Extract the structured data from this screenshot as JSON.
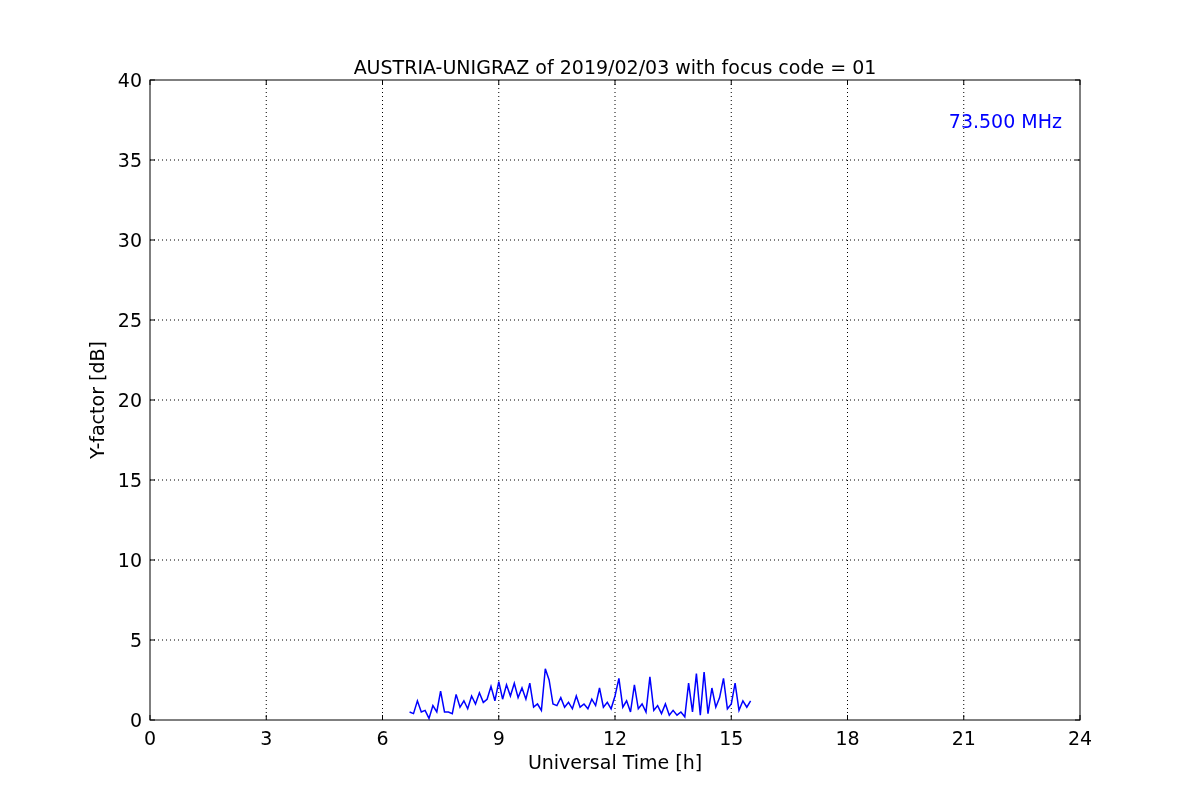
{
  "chart_data": {
    "type": "line",
    "title": "AUSTRIA-UNIGRAZ of 2019/02/03 with focus code = 01",
    "xlabel": "Universal Time [h]",
    "ylabel": "Y-factor [dB]",
    "xlim": [
      0,
      24
    ],
    "ylim": [
      0,
      40
    ],
    "xticks": [
      0,
      3,
      6,
      9,
      12,
      15,
      18,
      21,
      24
    ],
    "yticks": [
      0,
      5,
      10,
      15,
      20,
      25,
      30,
      35,
      40
    ],
    "x": [
      6.7,
      6.8,
      6.9,
      7.0,
      7.1,
      7.2,
      7.3,
      7.4,
      7.5,
      7.6,
      7.7,
      7.8,
      7.9,
      8.0,
      8.1,
      8.2,
      8.3,
      8.4,
      8.5,
      8.6,
      8.7,
      8.8,
      8.9,
      9.0,
      9.1,
      9.2,
      9.3,
      9.4,
      9.5,
      9.6,
      9.7,
      9.8,
      9.9,
      10.0,
      10.1,
      10.2,
      10.3,
      10.4,
      10.5,
      10.6,
      10.7,
      10.8,
      10.9,
      11.0,
      11.1,
      11.2,
      11.3,
      11.4,
      11.5,
      11.6,
      11.7,
      11.8,
      11.9,
      12.0,
      12.1,
      12.2,
      12.3,
      12.4,
      12.5,
      12.6,
      12.7,
      12.8,
      12.9,
      13.0,
      13.1,
      13.2,
      13.3,
      13.4,
      13.5,
      13.6,
      13.7,
      13.8,
      13.9,
      14.0,
      14.1,
      14.2,
      14.3,
      14.4,
      14.5,
      14.6,
      14.7,
      14.8,
      14.9,
      15.0,
      15.1,
      15.2,
      15.3,
      15.4,
      15.5
    ],
    "series": [
      {
        "name": "73.500 MHz",
        "color": "#0000ff",
        "values": [
          0.5,
          0.4,
          1.2,
          0.5,
          0.6,
          0.1,
          0.9,
          0.5,
          1.8,
          0.5,
          0.5,
          0.4,
          1.6,
          0.8,
          1.2,
          0.7,
          1.5,
          1.0,
          1.7,
          1.1,
          1.3,
          2.1,
          1.2,
          2.4,
          1.3,
          2.2,
          1.5,
          2.3,
          1.4,
          2.0,
          1.3,
          2.3,
          0.8,
          1.0,
          0.6,
          3.2,
          2.5,
          1.0,
          0.9,
          1.4,
          0.8,
          1.1,
          0.7,
          1.5,
          0.8,
          1.0,
          0.7,
          1.3,
          0.9,
          2.0,
          0.8,
          1.1,
          0.7,
          1.5,
          2.6,
          0.8,
          1.2,
          0.5,
          2.2,
          0.7,
          1.0,
          0.5,
          2.7,
          0.6,
          0.9,
          0.4,
          1.0,
          0.3,
          0.6,
          0.3,
          0.5,
          0.2,
          2.3,
          0.5,
          2.9,
          0.3,
          3.0,
          0.4,
          2.0,
          0.8,
          1.4,
          2.6,
          0.7,
          1.0,
          2.3,
          0.6,
          1.2,
          0.8,
          1.2
        ]
      }
    ],
    "grid": true
  }
}
